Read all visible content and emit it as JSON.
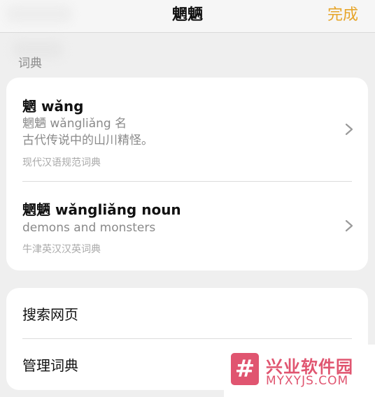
{
  "nav": {
    "title": "魍魉",
    "done_label": "完成"
  },
  "section": {
    "label": "词典"
  },
  "entries": [
    {
      "title": "魍 wǎng",
      "lines": [
        "魍魉 wǎngliǎng 名",
        "古代传说中的山川精怪。"
      ],
      "source": "现代汉语规范词典"
    },
    {
      "title": "魍魉 wǎngliǎng noun",
      "lines": [
        "demons and monsters"
      ],
      "source": "牛津英汉汉英词典"
    }
  ],
  "actions": {
    "search_web": "搜索网页",
    "manage_dictionaries": "管理词典"
  },
  "watermark": {
    "symbol": "#",
    "name": "兴业软件园",
    "domain": "MYXYJS.COM"
  },
  "colors": {
    "accent": "#e6a52a",
    "watermark": "#e05570"
  },
  "icons": {
    "entry_chevron": "chevron-right-icon"
  }
}
